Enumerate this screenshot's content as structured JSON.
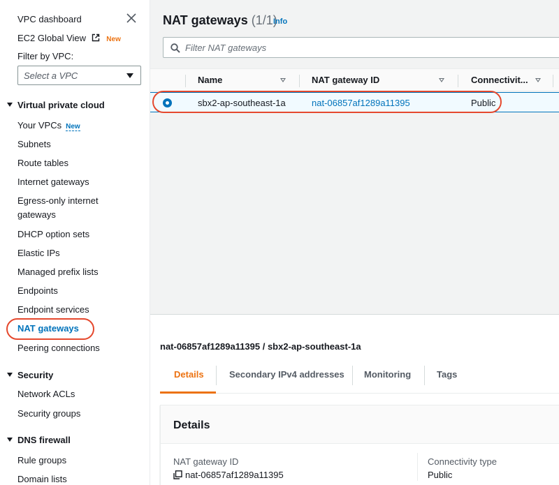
{
  "sidebar": {
    "vpc_dashboard": "VPC dashboard",
    "ec2_global_view": "EC2 Global View",
    "ec2_badge": "New",
    "filter_label": "Filter by VPC:",
    "select_placeholder": "Select a VPC",
    "sections": {
      "virtual_private_cloud": "Virtual private cloud",
      "security": "Security",
      "dns_firewall": "DNS firewall"
    },
    "vpc_items": [
      "Your VPCs",
      "Subnets",
      "Route tables",
      "Internet gateways",
      "Egress-only internet",
      "gateways",
      "DHCP option sets",
      "Elastic IPs",
      "Managed prefix lists",
      "Endpoints",
      "Endpoint services",
      "NAT gateways",
      "Peering connections"
    ],
    "your_vpcs_badge": "New",
    "security_items": [
      "Network ACLs",
      "Security groups"
    ],
    "dns_items": [
      "Rule groups",
      "Domain lists"
    ]
  },
  "main": {
    "title": "NAT gateways",
    "count": "(1/1)",
    "info": "Info",
    "search_placeholder": "Filter NAT gateways",
    "columns": [
      "Name",
      "NAT gateway ID",
      "Connectivit..."
    ],
    "row": {
      "name": "sbx2-ap-southeast-1a",
      "id": "nat-06857af1289a11395",
      "connectivity": "Public"
    },
    "detail_heading": "nat-06857af1289a11395 / sbx2-ap-southeast-1a",
    "tabs": [
      "Details",
      "Secondary IPv4 addresses",
      "Monitoring",
      "Tags"
    ],
    "card": {
      "title": "Details",
      "label_id": "NAT gateway ID",
      "value_id": "nat-06857af1289a11395",
      "label_conn": "Connectivity type",
      "value_conn": "Public"
    }
  },
  "colors": {
    "link": "#0073bb",
    "accent_orange": "#ec7211",
    "annotation_red": "#e5482d"
  }
}
